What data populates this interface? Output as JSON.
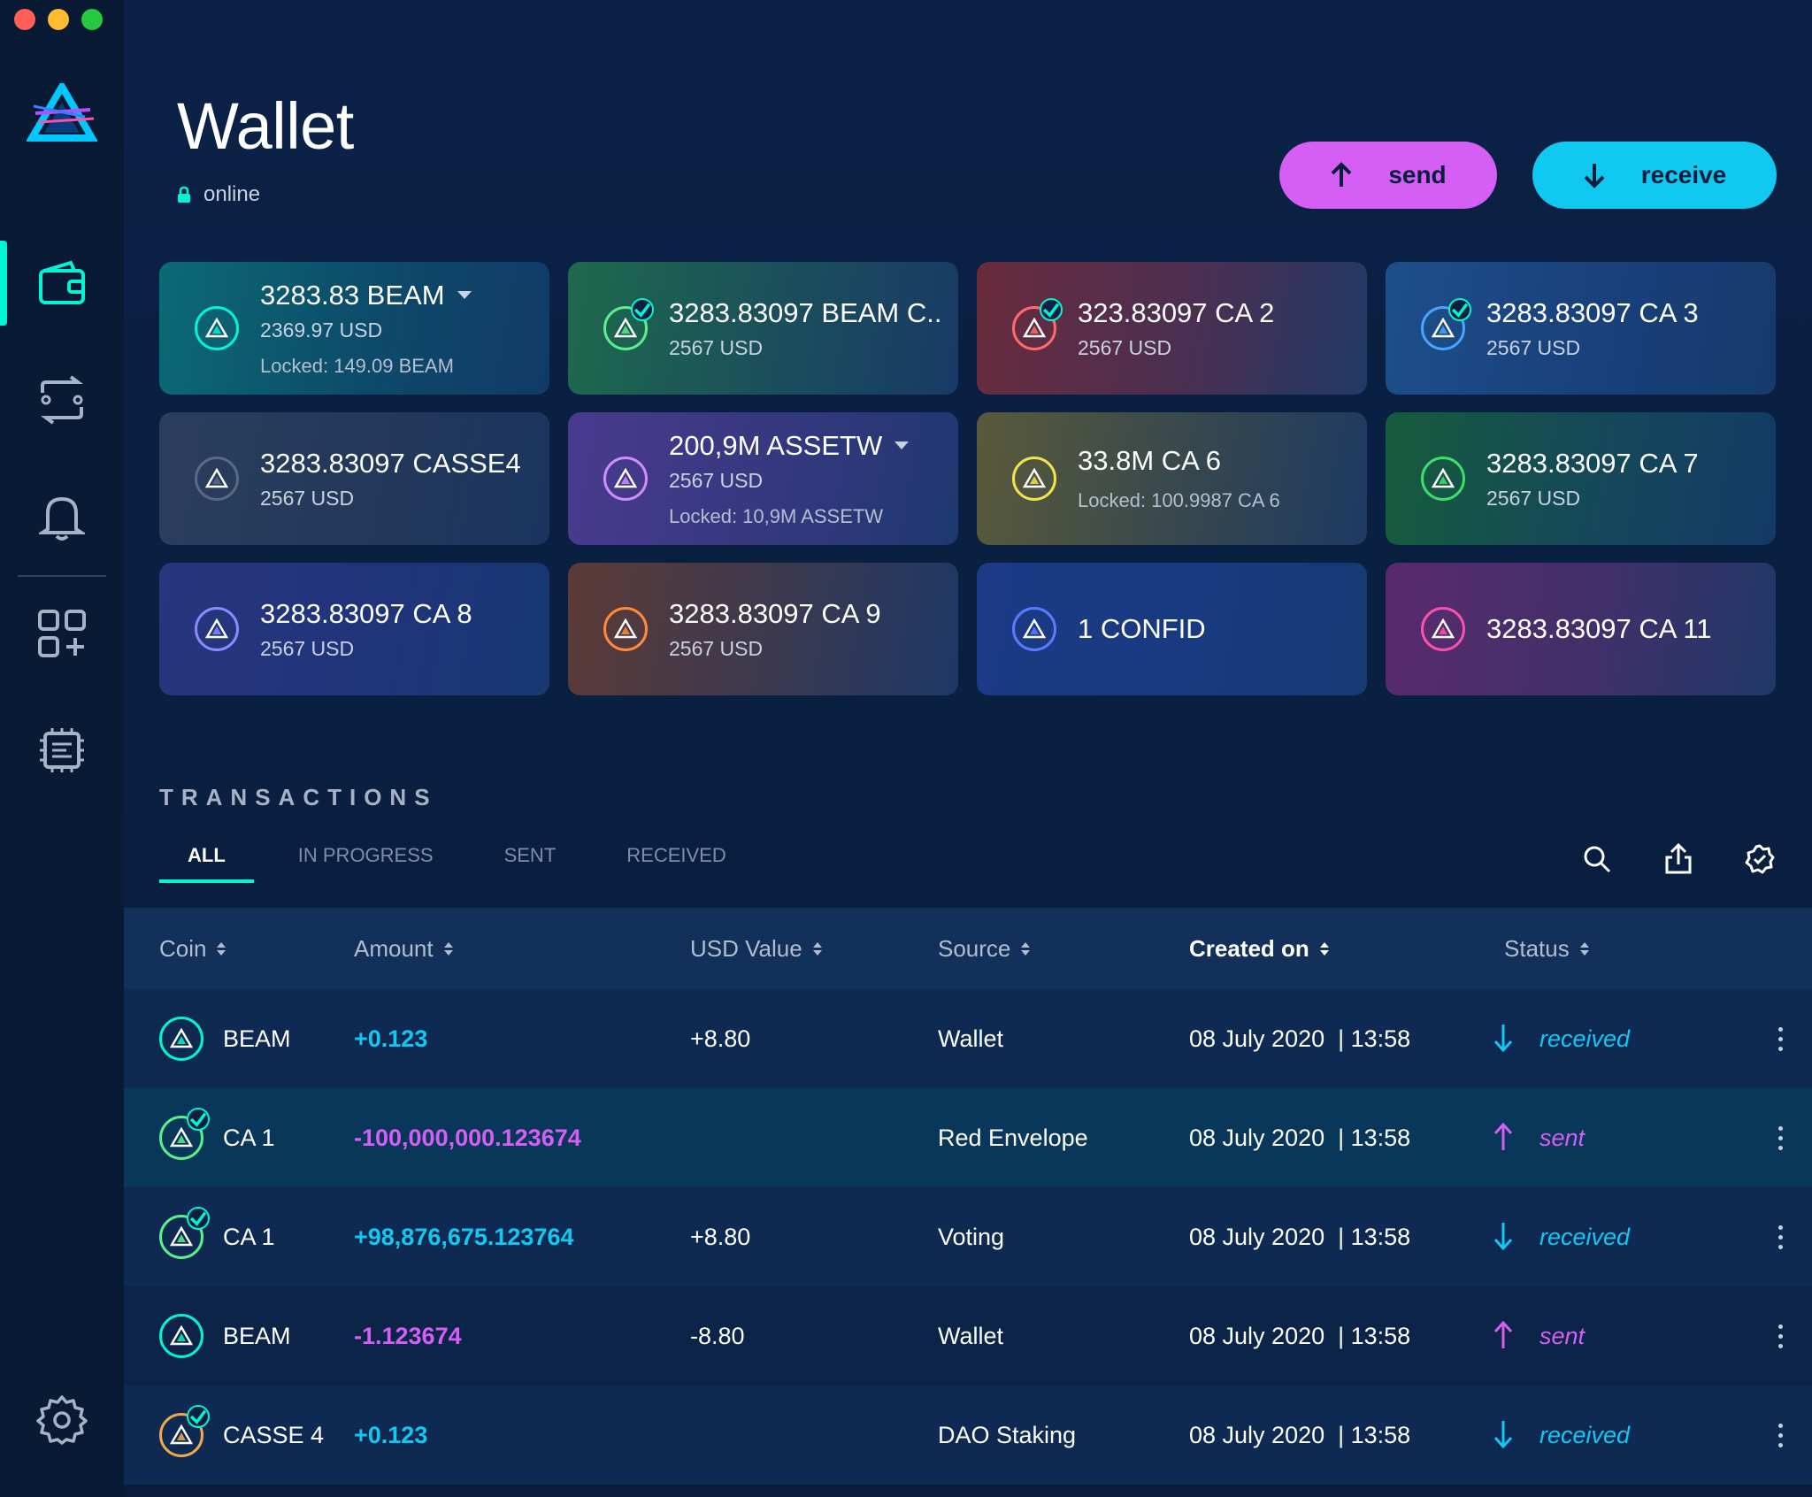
{
  "window": {
    "controls": [
      "#ff5f57",
      "#febc2e",
      "#28c840"
    ]
  },
  "header": {
    "title": "Wallet",
    "status": "online"
  },
  "actions": {
    "send": "send",
    "receive": "receive"
  },
  "assets": [
    {
      "amount": "3283.83 BEAM",
      "usd": "2369.97 USD",
      "locked": "Locked: 149.09 BEAM",
      "dropdown": true,
      "color": "#00f6d2",
      "verified": false,
      "bg": "linear-gradient(100deg,#0b6a74 0%,#0d4a6a 55%,#123a68 100%)"
    },
    {
      "amount": "3283.83097 BEAM C..",
      "usd": "2567 USD",
      "locked": "",
      "dropdown": false,
      "color": "#5bf08a",
      "verified": true,
      "bg": "linear-gradient(100deg,#1e6a4c 0%,#1b4e5c 55%,#183a66 100%)"
    },
    {
      "amount": "323.83097 CA 2",
      "usd": "2567 USD",
      "locked": "",
      "dropdown": false,
      "color": "#ff6b6b",
      "verified": true,
      "bg": "linear-gradient(100deg,#6a2b3c 0%,#4a2f52 55%,#213a66 100%)"
    },
    {
      "amount": "3283.83097 CA 3",
      "usd": "2567 USD",
      "locked": "",
      "dropdown": false,
      "color": "#4aa3ff",
      "verified": true,
      "bg": "linear-gradient(100deg,#1d4f8a 0%,#19407a 55%,#163a6c 100%)"
    },
    {
      "amount": "3283.83097 CASSE4",
      "usd": "2567 USD",
      "locked": "",
      "dropdown": false,
      "color": "#5a6a82",
      "verified": false,
      "bg": "linear-gradient(100deg,#2b3e5c 0%,#23385a 55%,#1b3560 100%)"
    },
    {
      "amount": "200,9M ASSETW",
      "usd": "2567 USD",
      "locked": "Locked: 10,9M ASSETW",
      "dropdown": true,
      "color": "#d08cff",
      "verified": false,
      "bg": "linear-gradient(100deg,#4a3a8e 0%,#34387e 55%,#1f3870 100%)"
    },
    {
      "amount": "33.8M CA 6",
      "usd": "",
      "locked": "Locked: 100.9987 CA 6",
      "dropdown": false,
      "color": "#f3e34a",
      "verified": false,
      "bg": "linear-gradient(100deg,#5a5a3a 0%,#36474e 55%,#1d3a62 100%)"
    },
    {
      "amount": "3283.83097 CA 7",
      "usd": "2567 USD",
      "locked": "",
      "dropdown": false,
      "color": "#3ee06a",
      "verified": false,
      "bg": "linear-gradient(100deg,#165c3c 0%,#14485a 55%,#133a66 100%)"
    },
    {
      "amount": "3283.83097 CA 8",
      "usd": "2567 USD",
      "locked": "",
      "dropdown": false,
      "color": "#8a8aff",
      "verified": false,
      "bg": "linear-gradient(100deg,#27367e 0%,#20347a 55%,#173872 100%)"
    },
    {
      "amount": "3283.83097 CA 9",
      "usd": "2567 USD",
      "locked": "",
      "dropdown": false,
      "color": "#ff8a3d",
      "verified": false,
      "bg": "linear-gradient(100deg,#5c3a36 0%,#3a3950 55%,#1d3866 100%)"
    },
    {
      "amount": "1 CONFID",
      "usd": "",
      "locked": "",
      "dropdown": false,
      "color": "#5b7bff",
      "verified": false,
      "bg": "linear-gradient(100deg,#1c3a86 0%,#183a80 55%,#153a74 100%)"
    },
    {
      "amount": "3283.83097 CA 11",
      "usd": "",
      "locked": "",
      "dropdown": false,
      "color": "#ff4fae",
      "verified": false,
      "bg": "linear-gradient(100deg,#5a2a6e 0%,#40306a 55%,#203868 100%)"
    }
  ],
  "transactions": {
    "title": "TRANSACTIONS",
    "tabs": [
      "ALL",
      "IN PROGRESS",
      "SENT",
      "RECEIVED"
    ],
    "active_tab": "ALL",
    "columns": [
      "Coin",
      "Amount",
      "USD Value",
      "Source",
      "Created on",
      "Status"
    ],
    "rows": [
      {
        "coin": "BEAM",
        "coin_color": "#00f6d2",
        "verified": false,
        "amount": "+0.123",
        "sign": "pos",
        "usd": "+8.80",
        "source": "Wallet",
        "date": "08 July 2020  | 13:58",
        "status": "received",
        "highlight": false
      },
      {
        "coin": "CA 1",
        "coin_color": "#5bf08a",
        "verified": true,
        "amount": "-100,000,000.123674",
        "sign": "neg",
        "usd": "",
        "source": "Red Envelope",
        "date": "08 July 2020  | 13:58",
        "status": "sent",
        "highlight": true
      },
      {
        "coin": "CA 1",
        "coin_color": "#5bf08a",
        "verified": true,
        "amount": "+98,876,675.123764",
        "sign": "pos",
        "usd": "+8.80",
        "source": "Voting",
        "date": "08 July 2020  | 13:58",
        "status": "received",
        "highlight": false
      },
      {
        "coin": "BEAM",
        "coin_color": "#00f6d2",
        "verified": false,
        "amount": "-1.123674",
        "sign": "neg",
        "usd": "-8.80",
        "source": "Wallet",
        "date": "08 July 2020  | 13:58",
        "status": "sent",
        "highlight": false
      },
      {
        "coin": "CASSE 4",
        "coin_color": "#f0a94a",
        "verified": true,
        "amount": "+0.123",
        "sign": "pos",
        "usd": "",
        "source": "DAO Staking",
        "date": "08 July 2020  | 13:58",
        "status": "received",
        "highlight": false
      }
    ]
  },
  "colors": {
    "accent": "#00f6d2",
    "send": "#d55ef5",
    "receive": "#10c8f0"
  }
}
